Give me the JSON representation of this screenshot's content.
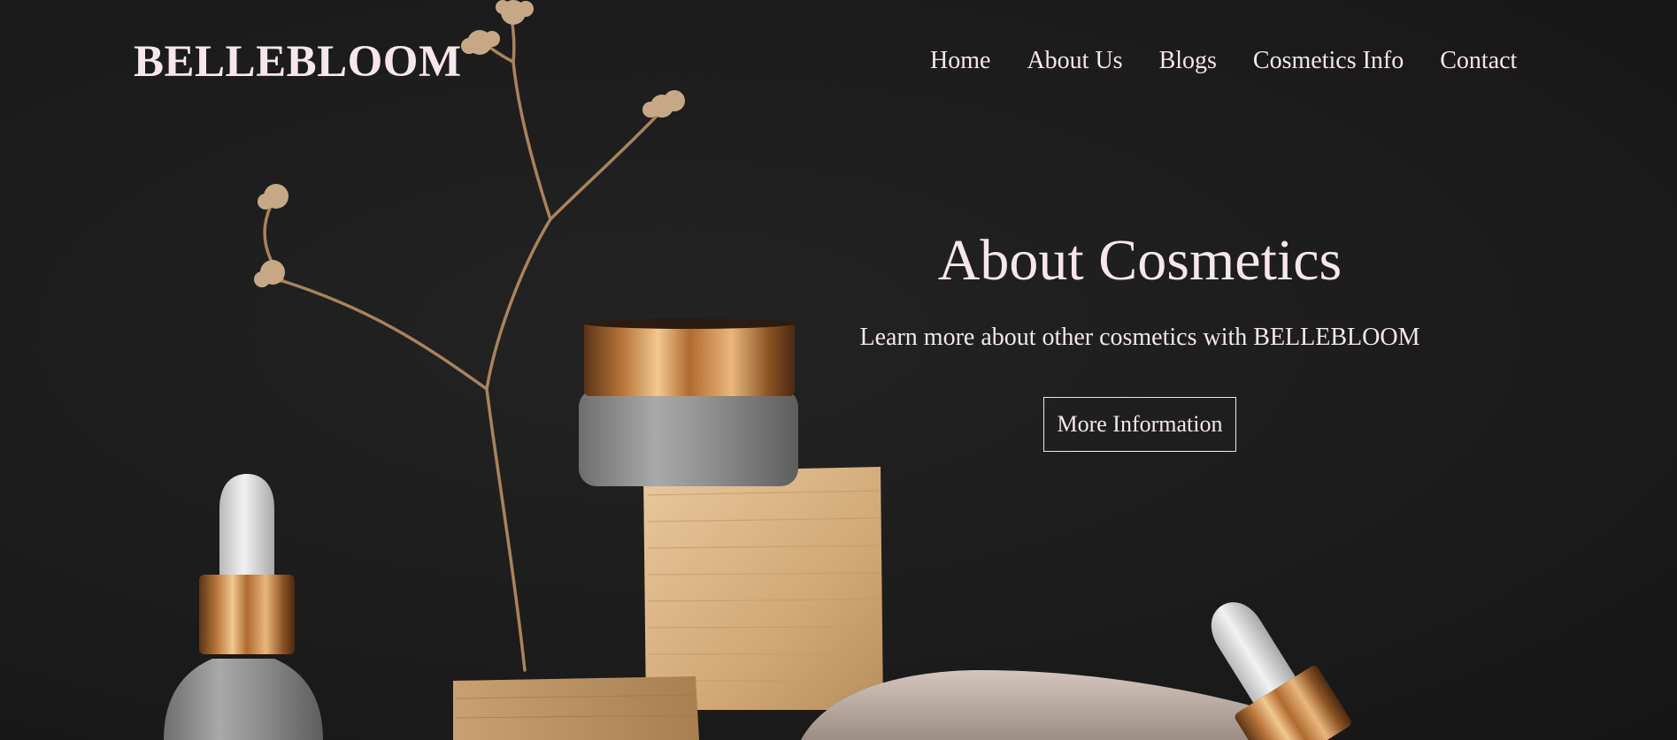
{
  "brand": {
    "logo_text": "BELLEBLOOM"
  },
  "nav": {
    "items": [
      {
        "label": "Home"
      },
      {
        "label": "About Us"
      },
      {
        "label": "Blogs"
      },
      {
        "label": "Cosmetics Info"
      },
      {
        "label": "Contact"
      }
    ]
  },
  "hero": {
    "title": "About Cosmetics",
    "subtitle": "Learn more about other cosmetics with BELLEBLOOM",
    "cta_label": "More Information"
  },
  "colors": {
    "background": "#1b1b1b",
    "text": "#f7e6ea",
    "accent_gold": "#b8874f",
    "wood": "#d9b58a"
  }
}
